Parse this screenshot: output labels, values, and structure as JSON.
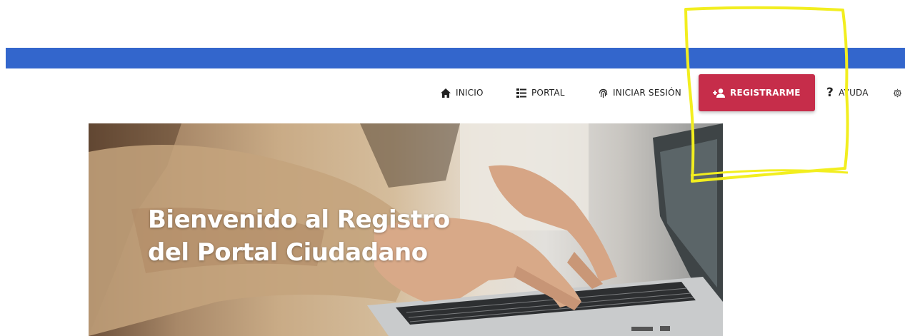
{
  "nav": {
    "items": [
      {
        "label": "INICIO",
        "icon": "home-icon"
      },
      {
        "label": "PORTAL",
        "icon": "list-icon"
      },
      {
        "label": "INICIAR SESIÓN",
        "icon": "fingerprint-icon"
      },
      {
        "label": "REGISTRARME",
        "icon": "add-user-icon"
      },
      {
        "label": "AYUDA",
        "icon": "question-icon"
      }
    ]
  },
  "hero": {
    "title_line1": "Bienvenido al Registro",
    "title_line2": "del Portal Ciudadano"
  },
  "colors": {
    "header_bar": "#3366cc",
    "register_button": "#c62d4a",
    "annotation": "#f2ee1f"
  }
}
